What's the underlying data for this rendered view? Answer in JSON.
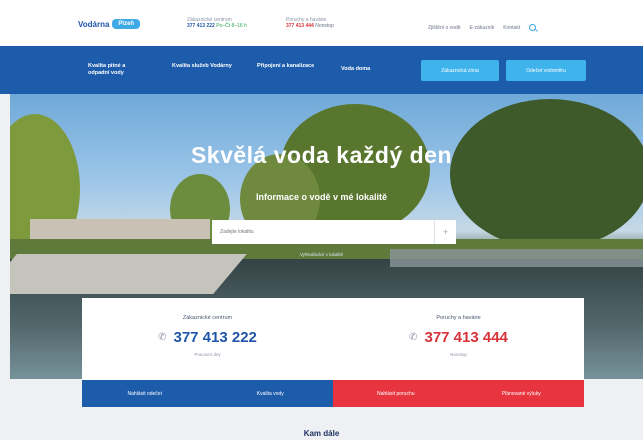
{
  "header": {
    "logo_word": "Vodárna",
    "logo_pill": "Plzeň",
    "contact_customer": {
      "label": "Zákaznické centrum",
      "phone": "377 413 222",
      "note": "Po–Čt 8–16 h"
    },
    "contact_faults": {
      "label": "Poruchy a havárie",
      "phone": "377 413 444",
      "note": "Nonstop"
    },
    "links": [
      "Zjištění o vodě",
      "E-zákazník",
      "Kontakt"
    ]
  },
  "nav": {
    "items": [
      "Kvalita pitné a odpadní vody",
      "Kvalita služeb Vodárny",
      "Připojení a kanalizace",
      "Voda doma"
    ],
    "buttons": [
      "Zákaznická zóna",
      "Odečet vodoměru"
    ]
  },
  "hero": {
    "title": "Skvělá voda každý den",
    "subtitle": "Informace o vodě v mé lokalitě",
    "search_placeholder": "Zadejte lokalitu",
    "plus_symbol": "+",
    "location_link": "Vyhledávání v lokalitě"
  },
  "card": {
    "left": {
      "label": "Zákaznické centrum",
      "phone": "377 413 222",
      "note": "Pracovní dny"
    },
    "right": {
      "label": "Poruchy a havárie",
      "phone": "377 413 444",
      "note": "Nonstop"
    },
    "phone_symbol": "✆"
  },
  "actions": [
    "Nahlásit odečet",
    "Kvalita vody",
    "Nahlásit poruchu",
    "Plánované výluky"
  ],
  "footer_heading": "Kam dále",
  "colors": {
    "primary": "#1d5bab",
    "accent": "#3fb3ec",
    "alert": "#e8343e"
  }
}
